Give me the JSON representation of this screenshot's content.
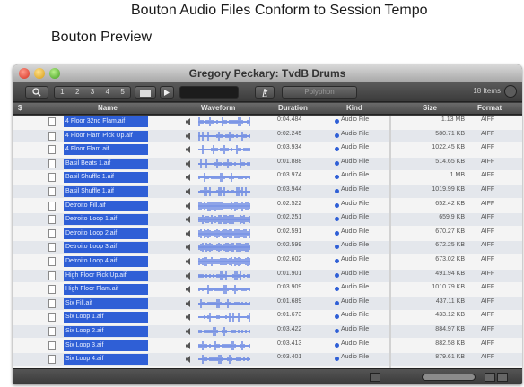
{
  "annotations": {
    "tempo_button": "Bouton Audio Files Conform to Session Tempo",
    "preview_button": "Bouton Preview"
  },
  "window": {
    "title": "Gregory Peckary: TvdB Drums",
    "toolbar": {
      "zoom_levels": [
        "1",
        "2",
        "3",
        "4",
        "5"
      ],
      "polyphony": "Polyphon",
      "item_count": "18 Items"
    },
    "columns": {
      "index": "$",
      "name": "Name",
      "waveform": "Waveform",
      "duration": "Duration",
      "kind": "Kind",
      "size": "Size",
      "format": "Format"
    },
    "files": [
      {
        "name": "4 Floor 32nd Flam.aif",
        "duration": "0:04.484",
        "kind": "Audio File",
        "size": "1.13 MB",
        "format": "AIFF"
      },
      {
        "name": "4 Floor Flam Pick Up.aif",
        "duration": "0:02.245",
        "kind": "Audio File",
        "size": "580.71 KB",
        "format": "AIFF"
      },
      {
        "name": "4 Floor Flam.aif",
        "duration": "0:03.934",
        "kind": "Audio File",
        "size": "1022.45 KB",
        "format": "AIFF"
      },
      {
        "name": "Basil Beats 1.aif",
        "duration": "0:01.888",
        "kind": "Audio File",
        "size": "514.65 KB",
        "format": "AIFF"
      },
      {
        "name": "Basil Shuffle 1.aif",
        "duration": "0:03.974",
        "kind": "Audio File",
        "size": "1 MB",
        "format": "AIFF"
      },
      {
        "name": "Basil Shuffle 1.aif",
        "duration": "0:03.944",
        "kind": "Audio File",
        "size": "1019.99 KB",
        "format": "AIFF"
      },
      {
        "name": "Detroito Fill.aif",
        "duration": "0:02.522",
        "kind": "Audio File",
        "size": "652.42 KB",
        "format": "AIFF"
      },
      {
        "name": "Detroito Loop 1.aif",
        "duration": "0:02.251",
        "kind": "Audio File",
        "size": "659.9 KB",
        "format": "AIFF"
      },
      {
        "name": "Detroito Loop 2.aif",
        "duration": "0:02.591",
        "kind": "Audio File",
        "size": "670.27 KB",
        "format": "AIFF"
      },
      {
        "name": "Detroito Loop 3.aif",
        "duration": "0:02.599",
        "kind": "Audio File",
        "size": "672.25 KB",
        "format": "AIFF"
      },
      {
        "name": "Detroito Loop 4.aif",
        "duration": "0:02.602",
        "kind": "Audio File",
        "size": "673.02 KB",
        "format": "AIFF"
      },
      {
        "name": "High Floor Pick Up.aif",
        "duration": "0:01.901",
        "kind": "Audio File",
        "size": "491.94 KB",
        "format": "AIFF"
      },
      {
        "name": "High Floor Flam.aif",
        "duration": "0:03.909",
        "kind": "Audio File",
        "size": "1010.79 KB",
        "format": "AIFF"
      },
      {
        "name": "Six Fill.aif",
        "duration": "0:01.689",
        "kind": "Audio File",
        "size": "437.11 KB",
        "format": "AIFF"
      },
      {
        "name": "Six Loop 1.aif",
        "duration": "0:01.673",
        "kind": "Audio File",
        "size": "433.12 KB",
        "format": "AIFF"
      },
      {
        "name": "Six Loop 2.aif",
        "duration": "0:03.422",
        "kind": "Audio File",
        "size": "884.97 KB",
        "format": "AIFF"
      },
      {
        "name": "Six Loop 3.aif",
        "duration": "0:03.413",
        "kind": "Audio File",
        "size": "882.58 KB",
        "format": "AIFF"
      },
      {
        "name": "Six Loop 4.aif",
        "duration": "0:03.401",
        "kind": "Audio File",
        "size": "879.61 KB",
        "format": "AIFF"
      }
    ]
  }
}
